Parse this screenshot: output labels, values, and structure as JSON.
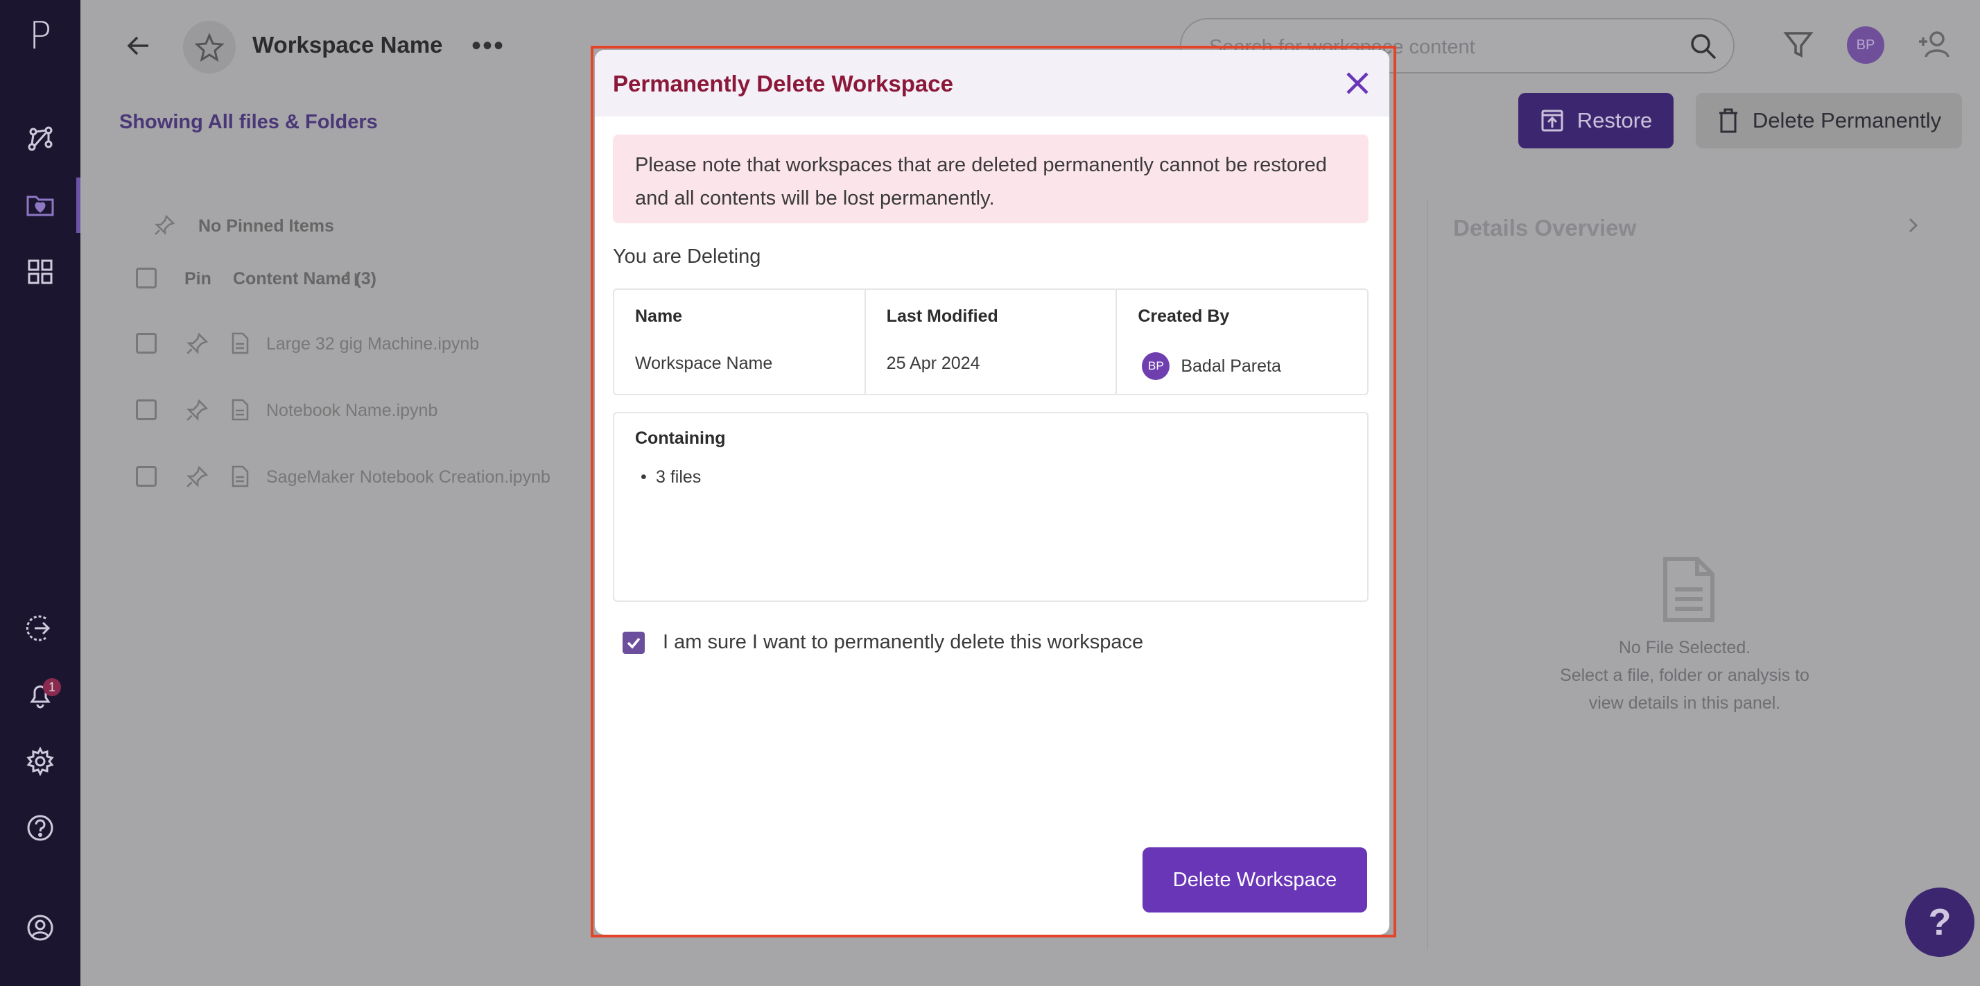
{
  "sidebar": {
    "logo": "P",
    "notification_count": "1"
  },
  "header": {
    "workspace_name": "Workspace Name",
    "search_placeholder": "Search for workspace content",
    "avatar_initials": "BP"
  },
  "toolbar": {
    "showing_label": "Showing All files & Folders",
    "restore_label": "Restore",
    "delete_permanently_label": "Delete Permanently"
  },
  "content": {
    "no_pinned_label": "No Pinned Items",
    "columns": {
      "pin": "Pin",
      "name": "Content Name (3)"
    },
    "files": [
      "Large 32 gig Machine.ipynb",
      "Notebook Name.ipynb",
      "SageMaker Notebook Creation.ipynb"
    ]
  },
  "details": {
    "title": "Details Overview",
    "empty_title": "No File Selected.",
    "empty_line1": "Select a file, folder or analysis to",
    "empty_line2": "view details in this panel."
  },
  "modal": {
    "title": "Permanently Delete Workspace",
    "warning": "Please note that workspaces that are deleted permanently cannot be restored and all contents will be lost permanently.",
    "deleting_label": "You are Deleting",
    "table": {
      "name_header": "Name",
      "name_value": "Workspace Name",
      "modified_header": "Last Modified",
      "modified_value": "25 Apr 2024",
      "created_header": "Created By",
      "creator_initials": "BP",
      "creator_name": "Badal Pareta"
    },
    "containing_header": "Containing",
    "containing_items": [
      "3 files"
    ],
    "confirm_checked": true,
    "confirm_label": "I am sure I want to permanently delete this workspace",
    "delete_button": "Delete Workspace"
  },
  "help_fab": "?",
  "colors": {
    "sidebar_bg": "#1b1530",
    "primary": "#6a36b8",
    "danger_title": "#8b1838",
    "warning_bg": "#fce5ea",
    "highlight_outline": "#e2452a"
  }
}
